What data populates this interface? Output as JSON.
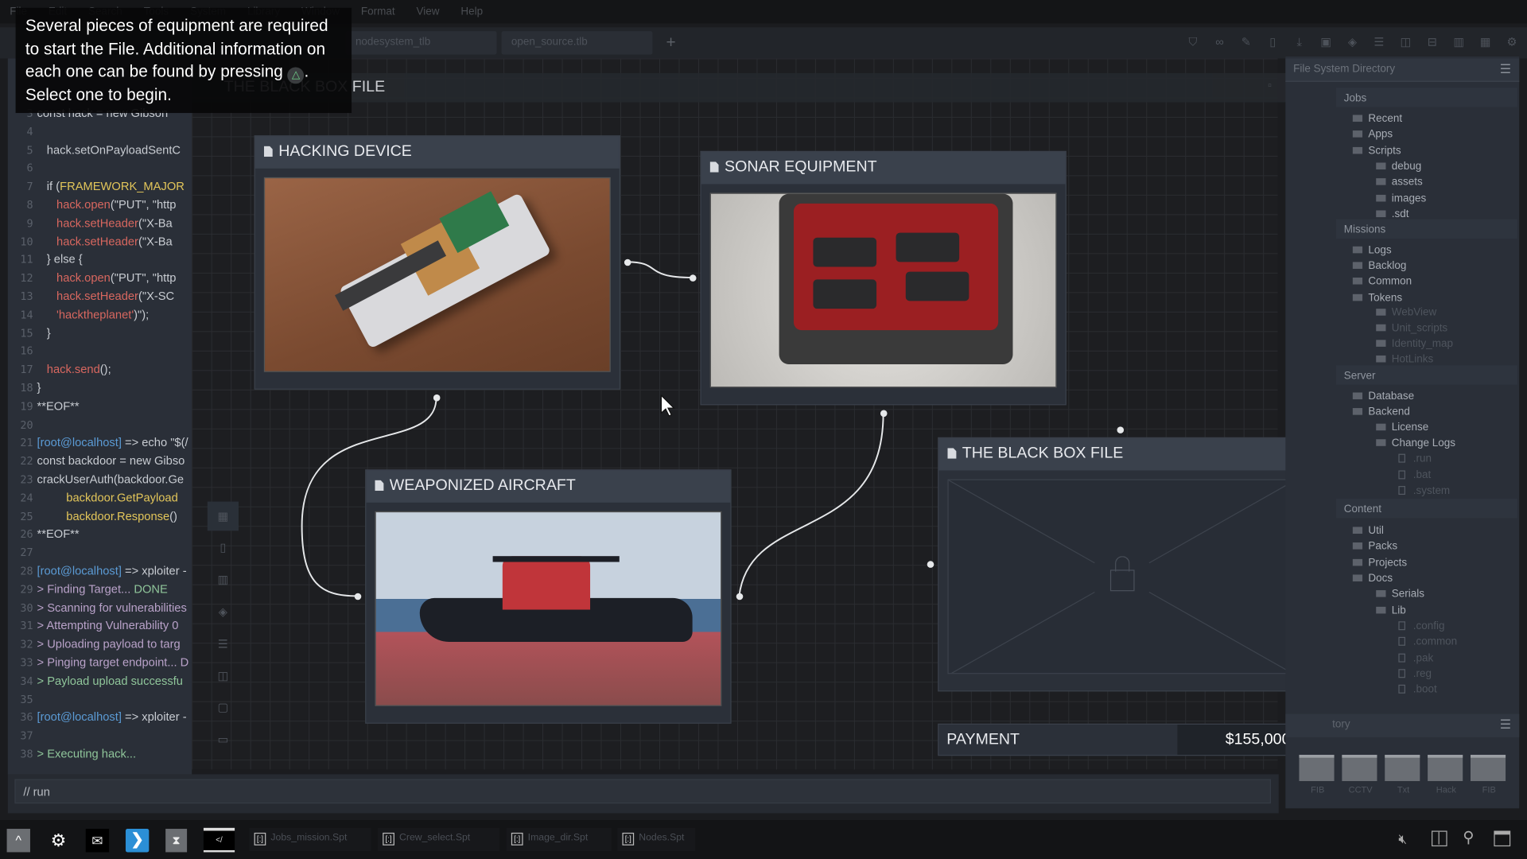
{
  "menu": [
    "File",
    "Edit",
    "Search",
    "Tools",
    "System",
    "Library",
    "Window",
    "Format",
    "View",
    "Help"
  ],
  "tabs": [
    {
      "label": "nodesystem_tlb"
    },
    {
      "label": "open_source.tlb"
    }
  ],
  "add_tab": "+",
  "toolbar_icons": [
    "shield-icon",
    "link-icon",
    "pencil-icon",
    "document-icon",
    "download-icon",
    "frame-icon",
    "layers-icon",
    "rows-icon",
    "columns-icon",
    "split-icon",
    "panels-icon",
    "grid-icon",
    "gear-icon"
  ],
  "tooltip": {
    "text_before": "Several pieces of equipment are required to start the File. Additional information on each one can be found by pressing ",
    "button": "△",
    "text_after": ". Select one to begin."
  },
  "canvas_title": "THE BLACK BOX FILE",
  "code": [
    {
      "n": "3",
      "s": [
        {
          "t": "const hack = new Gibson",
          "c": "d"
        }
      ]
    },
    {
      "n": "4",
      "s": []
    },
    {
      "n": "5",
      "s": [
        {
          "t": "   hack.setOnPayloadSentC",
          "c": "d"
        }
      ]
    },
    {
      "n": "6",
      "s": []
    },
    {
      "n": "7",
      "s": [
        {
          "t": "   if (",
          "c": "d"
        },
        {
          "t": "FRAMEWORK_MAJOR",
          "c": "y"
        }
      ]
    },
    {
      "n": "8",
      "s": [
        {
          "t": "      hack.open",
          "c": "r"
        },
        {
          "t": "(\"PUT\", \"http",
          "c": "d"
        }
      ]
    },
    {
      "n": "9",
      "s": [
        {
          "t": "      hack.setHeader",
          "c": "r"
        },
        {
          "t": "(\"X-Ba",
          "c": "d"
        }
      ]
    },
    {
      "n": "10",
      "s": [
        {
          "t": "      hack.setHeader",
          "c": "r"
        },
        {
          "t": "(\"X-Ba",
          "c": "d"
        }
      ]
    },
    {
      "n": "11",
      "s": [
        {
          "t": "   } else {",
          "c": "d"
        }
      ]
    },
    {
      "n": "12",
      "s": [
        {
          "t": "      hack.open",
          "c": "r"
        },
        {
          "t": "(\"PUT\", \"http",
          "c": "d"
        }
      ]
    },
    {
      "n": "13",
      "s": [
        {
          "t": "      hack.setHeader",
          "c": "r"
        },
        {
          "t": "(\"X-SC",
          "c": "d"
        }
      ]
    },
    {
      "n": "14",
      "s": [
        {
          "t": "      'hacktheplanet'",
          "c": "r"
        },
        {
          "t": ")\");",
          "c": "d"
        }
      ]
    },
    {
      "n": "15",
      "s": [
        {
          "t": "   }",
          "c": "d"
        }
      ]
    },
    {
      "n": "16",
      "s": []
    },
    {
      "n": "17",
      "s": [
        {
          "t": "   hack.send",
          "c": "r"
        },
        {
          "t": "();",
          "c": "d"
        }
      ]
    },
    {
      "n": "18",
      "s": [
        {
          "t": "}",
          "c": "d"
        }
      ]
    },
    {
      "n": "19",
      "s": [
        {
          "t": "**EOF**",
          "c": "d"
        }
      ]
    },
    {
      "n": "20",
      "s": []
    },
    {
      "n": "21",
      "s": [
        {
          "t": "[root@localhost]",
          "c": "b"
        },
        {
          "t": " => echo \"$(/",
          "c": "d"
        }
      ]
    },
    {
      "n": "22",
      "s": [
        {
          "t": "const backdoor = new Gibso",
          "c": "d"
        }
      ]
    },
    {
      "n": "23",
      "s": [
        {
          "t": "crackUserAuth(backdoor.Ge",
          "c": "d"
        }
      ]
    },
    {
      "n": "24",
      "s": [
        {
          "t": "         backdoor.GetPayload",
          "c": "y"
        }
      ]
    },
    {
      "n": "25",
      "s": [
        {
          "t": "         backdoor.Response",
          "c": "y"
        },
        {
          "t": "()",
          "c": "d"
        }
      ]
    },
    {
      "n": "26",
      "s": [
        {
          "t": "**EOF**",
          "c": "d"
        }
      ]
    },
    {
      "n": "27",
      "s": []
    },
    {
      "n": "28",
      "s": [
        {
          "t": "[root@localhost]",
          "c": "b"
        },
        {
          "t": " => xploiter -",
          "c": "d"
        }
      ]
    },
    {
      "n": "29",
      "s": [
        {
          "t": "> Finding Target... ",
          "c": "p"
        },
        {
          "t": "DONE",
          "c": "g"
        }
      ]
    },
    {
      "n": "30",
      "s": [
        {
          "t": "> Scanning for vulnerabilities",
          "c": "p"
        }
      ]
    },
    {
      "n": "31",
      "s": [
        {
          "t": "> Attempting Vulnerability 0",
          "c": "p"
        }
      ]
    },
    {
      "n": "32",
      "s": [
        {
          "t": "> Uploading payload to targ",
          "c": "p"
        }
      ]
    },
    {
      "n": "33",
      "s": [
        {
          "t": "> Pinging target endpoint... D",
          "c": "p"
        }
      ]
    },
    {
      "n": "34",
      "s": [
        {
          "t": "> Payload upload successfu",
          "c": "g"
        }
      ]
    },
    {
      "n": "35",
      "s": []
    },
    {
      "n": "36",
      "s": [
        {
          "t": "[root@localhost]",
          "c": "b"
        },
        {
          "t": " => xploiter -",
          "c": "d"
        }
      ]
    },
    {
      "n": "37",
      "s": []
    },
    {
      "n": "38",
      "s": [
        {
          "t": "> Executing hack...",
          "c": "g"
        }
      ]
    }
  ],
  "code_colors": {
    "d": "#c8ccd2",
    "y": "#e3c65a",
    "r": "#d8675f",
    "b": "#5b9bd5",
    "g": "#8fc59a",
    "p": "#b9a2c9"
  },
  "command_input": "// run",
  "nodes": {
    "hacking": {
      "title": "HACKING DEVICE"
    },
    "sonar": {
      "title": "SONAR EQUIPMENT"
    },
    "aircraft": {
      "title": "WEAPONIZED AIRCRAFT"
    },
    "blackbox": {
      "title": "THE BLACK BOX FILE",
      "locked": true
    }
  },
  "payment": {
    "label": "PAYMENT",
    "value": "$155,000"
  },
  "file_panel": {
    "title": "File System Directory",
    "tree": [
      {
        "t": "Jobs",
        "k": "s",
        "l": 0
      },
      {
        "t": "Recent",
        "k": "f",
        "l": 1
      },
      {
        "t": "Apps",
        "k": "f",
        "l": 1
      },
      {
        "t": "Scripts",
        "k": "f",
        "l": 1
      },
      {
        "t": "debug",
        "k": "f",
        "l": 2
      },
      {
        "t": "assets",
        "k": "f",
        "l": 2
      },
      {
        "t": "images",
        "k": "f",
        "l": 2
      },
      {
        "t": ".sdt",
        "k": "f",
        "l": 2
      },
      {
        "t": "Missions",
        "k": "s",
        "l": 0
      },
      {
        "t": "Logs",
        "k": "f",
        "l": 1
      },
      {
        "t": "Backlog",
        "k": "f",
        "l": 1
      },
      {
        "t": "Common",
        "k": "f",
        "l": 1
      },
      {
        "t": "Tokens",
        "k": "f",
        "l": 1
      },
      {
        "t": "WebView",
        "k": "f",
        "l": 2,
        "dim": true
      },
      {
        "t": "Unit_scripts",
        "k": "f",
        "l": 2,
        "dim": true
      },
      {
        "t": "Identity_map",
        "k": "f",
        "l": 2,
        "dim": true
      },
      {
        "t": "HotLinks",
        "k": "f",
        "l": 2,
        "dim": true
      },
      {
        "t": "Server",
        "k": "s",
        "l": 0
      },
      {
        "t": "Database",
        "k": "f",
        "l": 1
      },
      {
        "t": "Backend",
        "k": "f",
        "l": 1
      },
      {
        "t": "License",
        "k": "f",
        "l": 2
      },
      {
        "t": "Change Logs",
        "k": "f",
        "l": 2
      },
      {
        "t": ".run",
        "k": "d",
        "l": 3
      },
      {
        "t": ".bat",
        "k": "d",
        "l": 3
      },
      {
        "t": ".system",
        "k": "d",
        "l": 3
      },
      {
        "t": "Content",
        "k": "s",
        "l": 0
      },
      {
        "t": "Util",
        "k": "f",
        "l": 1
      },
      {
        "t": "Packs",
        "k": "f",
        "l": 1
      },
      {
        "t": "Projects",
        "k": "f",
        "l": 1
      },
      {
        "t": "Docs",
        "k": "f",
        "l": 1
      },
      {
        "t": "Serials",
        "k": "f",
        "l": 2
      },
      {
        "t": "Lib",
        "k": "f",
        "l": 2
      },
      {
        "t": ".config",
        "k": "d",
        "l": 3
      },
      {
        "t": ".common",
        "k": "d",
        "l": 3
      },
      {
        "t": ".pak",
        "k": "d",
        "l": 3
      },
      {
        "t": ".reg",
        "k": "d",
        "l": 3
      },
      {
        "t": ".boot",
        "k": "d",
        "l": 3
      }
    ]
  },
  "dir_panel": {
    "title_visible": "tory",
    "folders": [
      "FIB",
      "CCTV",
      "Txt",
      "Hack",
      "FIB"
    ]
  },
  "taskbar": {
    "items": [
      "Jobs_mission.Spt",
      "Crew_select.Spt",
      "Image_dir.Spt",
      "Nodes.Spt"
    ],
    "term_icon": "</"
  },
  "accent": "#2b8fd6"
}
